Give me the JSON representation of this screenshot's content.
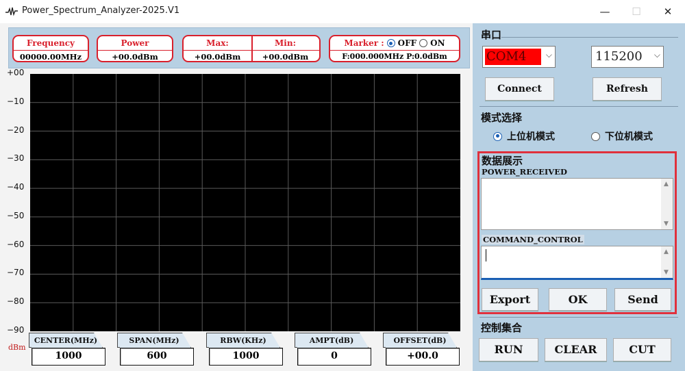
{
  "window": {
    "title": "Power_Spectrum_Analyzer-2025.V1",
    "minimize": "—",
    "maximize": "☐",
    "close": "✕"
  },
  "readout": {
    "frequency": {
      "label": "Frequency",
      "value": "00000.00MHz"
    },
    "power": {
      "label": "Power",
      "value": "+00.0dBm"
    },
    "max": {
      "label": "Max:",
      "value": "+00.0dBm"
    },
    "min": {
      "label": "Min:",
      "value": "+00.0dBm"
    },
    "marker": {
      "label": "Marker :",
      "off": "OFF",
      "on": "ON",
      "selected": "OFF",
      "value": "F:000.000MHz P:0.0dBm"
    }
  },
  "chart": {
    "unit": "dBm",
    "y_ticks": [
      "+00",
      "−10",
      "−20",
      "−30",
      "−40",
      "−50",
      "−60",
      "−70",
      "−80",
      "−90"
    ],
    "background": "#000000",
    "grid_color": "#5a5a5a",
    "grid_cols": 10,
    "grid_rows": 9
  },
  "params": [
    {
      "label": "CENTER(MHz)",
      "value": "1000"
    },
    {
      "label": "SPAN(MHz)",
      "value": "600"
    },
    {
      "label": "RBW(KHz)",
      "value": "1000"
    },
    {
      "label": "AMPT(dB)",
      "value": "0"
    },
    {
      "label": "OFFSET(dB)",
      "value": "+00.0"
    }
  ],
  "serial": {
    "title": "串口",
    "port": "COM4",
    "port_highlight": "#ff0000",
    "baud": "115200",
    "connect": "Connect",
    "refresh": "Refresh"
  },
  "mode": {
    "title": "模式选择",
    "upper": "上位机模式",
    "lower": "下位机模式",
    "selected": "upper"
  },
  "data_display": {
    "title": "数据展示",
    "received_label": "POWER_RECEIVED",
    "received_text": "",
    "command_label": "COMMAND_CONTROL",
    "command_text": "",
    "export": "Export",
    "ok": "OK",
    "send": "Send"
  },
  "control": {
    "title": "控制集合",
    "run": "RUN",
    "clear": "CLEAR",
    "cut": "CUT"
  },
  "colors": {
    "panel_blue": "#b7d0e3",
    "accent_red": "#d9202c"
  }
}
